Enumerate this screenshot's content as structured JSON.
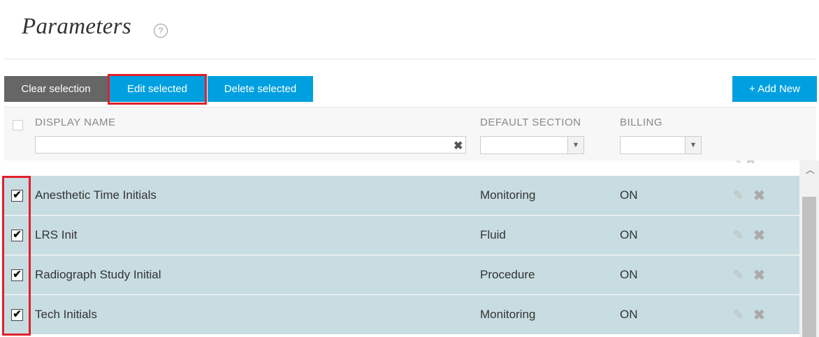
{
  "page": {
    "title": "Parameters",
    "help_icon": "?"
  },
  "toolbar": {
    "clear_label": "Clear selection",
    "edit_label": "Edit selected",
    "delete_label": "Delete selected",
    "add_label": "+ Add New"
  },
  "table": {
    "columns": {
      "display_name": "DISPLAY NAME",
      "default_section": "DEFAULT SECTION",
      "billing": "BILLING"
    },
    "filters": {
      "display_name": "",
      "default_section": "",
      "billing": ""
    },
    "rows": [
      {
        "name": "Anesthetic Time Initials",
        "section": "Monitoring",
        "billing": "ON",
        "checked": true
      },
      {
        "name": "LRS Init",
        "section": "Fluid",
        "billing": "ON",
        "checked": true
      },
      {
        "name": "Radiograph Study Initial",
        "section": "Procedure",
        "billing": "ON",
        "checked": true
      },
      {
        "name": "Tech Initials",
        "section": "Monitoring",
        "billing": "ON",
        "checked": true
      }
    ]
  },
  "icons": {
    "help": "question-circle-icon",
    "clear_filter": "close-icon",
    "edit": "pencil-icon",
    "delete": "close-icon",
    "scroll_up": "chevron-up-icon"
  },
  "colors": {
    "primary_button": "#00a0e0",
    "secondary_button": "#666666",
    "selected_row": "#c8dde1",
    "highlight": "#e0202a"
  }
}
